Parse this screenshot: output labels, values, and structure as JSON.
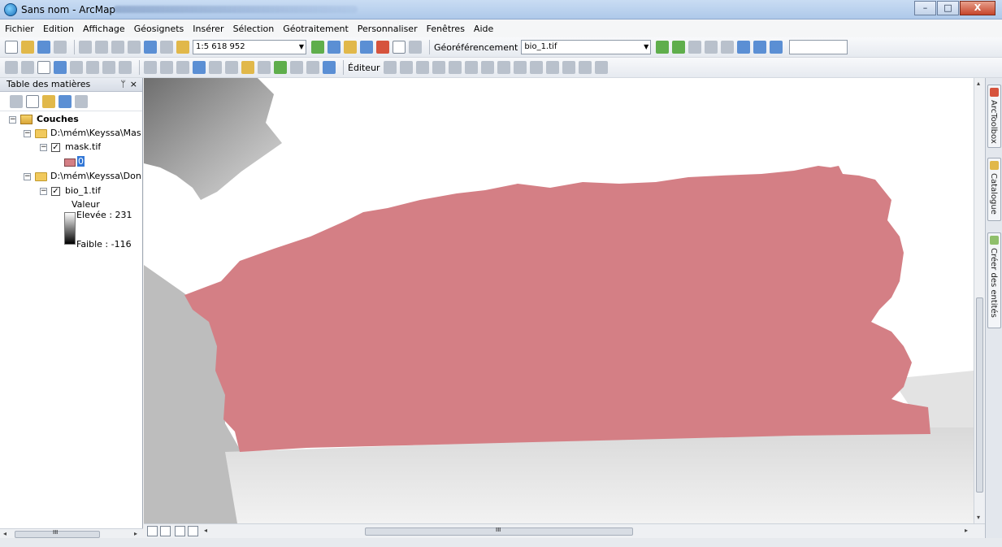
{
  "window": {
    "title": "Sans nom - ArcMap",
    "buttons": {
      "minimize": "–",
      "maximize": "□",
      "close": "X"
    }
  },
  "menu": [
    "Fichier",
    "Edition",
    "Affichage",
    "Géosignets",
    "Insérer",
    "Sélection",
    "Géotraitement",
    "Personnaliser",
    "Fenêtres",
    "Aide"
  ],
  "toolbar": {
    "scale": "1:5 618 952",
    "georef_label": "Géoréférencement",
    "georef_layer": "bio_1.tif",
    "editor_label": "Éditeur"
  },
  "toc": {
    "title": "Table des matières",
    "pin": "ᛘ",
    "close": "×",
    "root": "Couches",
    "groups": [
      {
        "path": "D:\\mém\\Keyssa\\Mask",
        "layer": "mask.tif",
        "value": "0"
      },
      {
        "path": "D:\\mém\\Keyssa\\Donn",
        "layer": "bio_1.tif",
        "legend_title": "Valeur",
        "high": "Elevée : 231",
        "low": "Faible : -116"
      }
    ]
  },
  "dock_tabs": [
    "ArcToolbox",
    "Catalogue",
    "Créer des entités"
  ],
  "colors": {
    "mask_fill": "#d47f85",
    "title_bar": "#b6cdee"
  },
  "scroll": {
    "grip": "III"
  }
}
